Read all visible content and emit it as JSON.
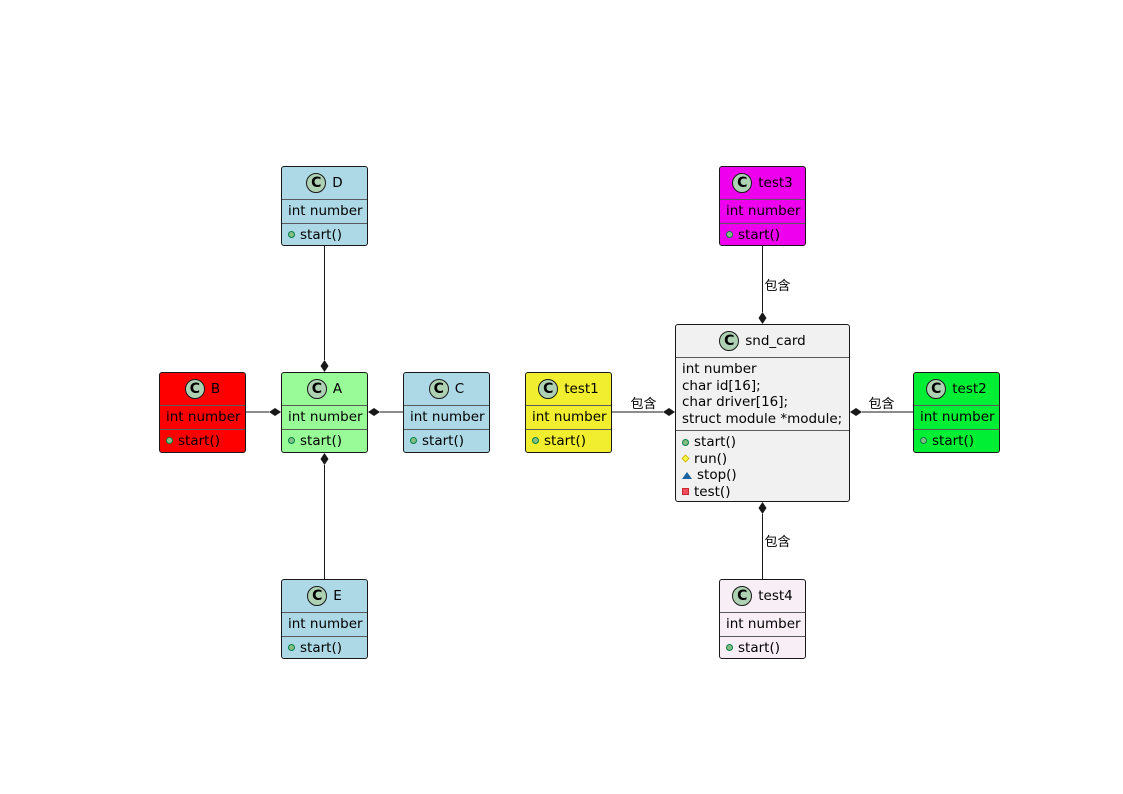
{
  "classes": [
    {
      "id": "D",
      "name": "D",
      "color": "#ADD8E6",
      "attributes": [
        "int number"
      ],
      "methods": [
        {
          "vis": "public",
          "text": "start()"
        }
      ]
    },
    {
      "id": "B",
      "name": "B",
      "color": "#FF0000",
      "attributes": [
        "int number"
      ],
      "methods": [
        {
          "vis": "public",
          "text": "start()"
        }
      ]
    },
    {
      "id": "A",
      "name": "A",
      "color": "#98FB98",
      "attributes": [
        "int number"
      ],
      "methods": [
        {
          "vis": "public",
          "text": "start()"
        }
      ]
    },
    {
      "id": "C",
      "name": "C",
      "color": "#ADD8E6",
      "attributes": [
        "int number"
      ],
      "methods": [
        {
          "vis": "public",
          "text": "start()"
        }
      ]
    },
    {
      "id": "E",
      "name": "E",
      "color": "#ADD8E6",
      "attributes": [
        "int number"
      ],
      "methods": [
        {
          "vis": "public",
          "text": "start()"
        }
      ]
    },
    {
      "id": "test3",
      "name": "test3",
      "color": "#EE00EE",
      "attributes": [
        "int number"
      ],
      "methods": [
        {
          "vis": "public",
          "text": "start()"
        }
      ]
    },
    {
      "id": "test1",
      "name": "test1",
      "color": "#F0EE2E",
      "attributes": [
        "int number"
      ],
      "methods": [
        {
          "vis": "public",
          "text": "start()"
        }
      ]
    },
    {
      "id": "snd_card",
      "name": "snd_card",
      "color": "#F1F1F1",
      "attributes": [
        "int number",
        "char id[16];",
        "char driver[16];",
        "struct module *module;"
      ],
      "methods": [
        {
          "vis": "public",
          "text": "start()"
        },
        {
          "vis": "protected",
          "text": "run()"
        },
        {
          "vis": "package",
          "text": "stop()"
        },
        {
          "vis": "private",
          "text": "test()"
        }
      ]
    },
    {
      "id": "test2",
      "name": "test2",
      "color": "#00EE33",
      "attributes": [
        "int number"
      ],
      "methods": [
        {
          "vis": "public",
          "text": "start()"
        }
      ]
    },
    {
      "id": "test4",
      "name": "test4",
      "color": "#F8EEF6",
      "attributes": [
        "int number"
      ],
      "methods": [
        {
          "vis": "public",
          "text": "start()"
        }
      ]
    }
  ],
  "relations": [
    {
      "from": "D",
      "to": "A",
      "type": "composition",
      "label": ""
    },
    {
      "from": "B",
      "to": "A",
      "type": "composition",
      "label": ""
    },
    {
      "from": "C",
      "to": "A",
      "type": "composition",
      "label": ""
    },
    {
      "from": "E",
      "to": "A",
      "type": "composition",
      "label": ""
    },
    {
      "from": "test3",
      "to": "snd_card",
      "type": "composition",
      "label": "包含"
    },
    {
      "from": "test1",
      "to": "snd_card",
      "type": "composition",
      "label": "包含"
    },
    {
      "from": "test2",
      "to": "snd_card",
      "type": "composition",
      "label": "包含"
    },
    {
      "from": "test4",
      "to": "snd_card",
      "type": "composition",
      "label": "包含"
    }
  ]
}
